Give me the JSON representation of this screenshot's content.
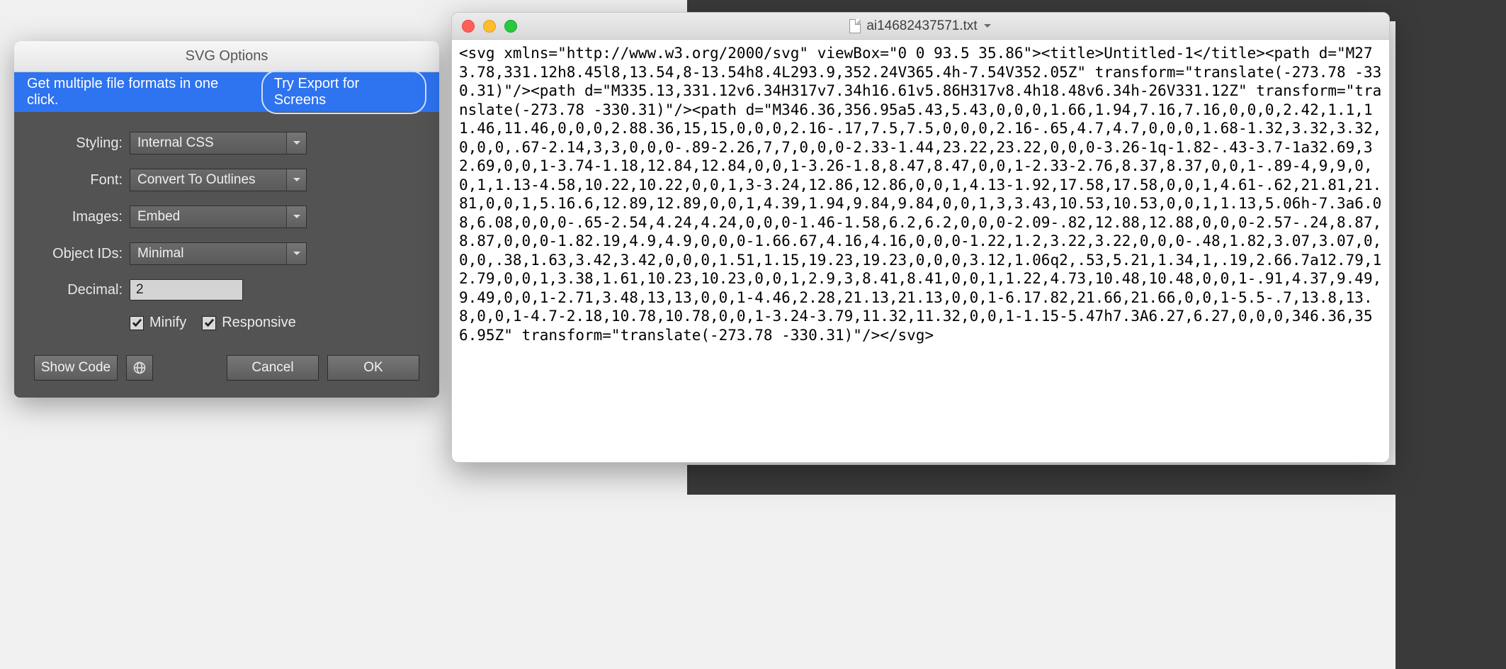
{
  "background": {
    "dark_right_visible": true
  },
  "dialog": {
    "title": "SVG Options",
    "banner_text": "Get multiple file formats in one click.",
    "banner_button": "Try Export for Screens",
    "rows": {
      "styling": {
        "label": "Styling:",
        "value": "Internal CSS"
      },
      "font": {
        "label": "Font:",
        "value": "Convert To Outlines"
      },
      "images": {
        "label": "Images:",
        "value": "Embed"
      },
      "objectids": {
        "label": "Object IDs:",
        "value": "Minimal"
      },
      "decimal": {
        "label": "Decimal:",
        "value": "2"
      }
    },
    "checks": {
      "minify": {
        "label": "Minify",
        "checked": true
      },
      "responsive": {
        "label": "Responsive",
        "checked": true
      }
    },
    "buttons": {
      "showcode": "Show Code",
      "cancel": "Cancel",
      "ok": "OK"
    }
  },
  "txtwindow": {
    "filename": "ai14682437571.txt",
    "content": "<svg xmlns=\"http://www.w3.org/2000/svg\" viewBox=\"0 0 93.5 35.86\"><title>Untitled-1</title><path d=\"M273.78,331.12h8.45l8,13.54,8-13.54h8.4L293.9,352.24V365.4h-7.54V352.05Z\" transform=\"translate(-273.78 -330.31)\"/><path d=\"M335.13,331.12v6.34H317v7.34h16.61v5.86H317v8.4h18.48v6.34h-26V331.12Z\" transform=\"translate(-273.78 -330.31)\"/><path d=\"M346.36,356.95a5.43,5.43,0,0,0,1.66,1.94,7.16,7.16,0,0,0,2.42,1.1,11.46,11.46,0,0,0,2.88.36,15,15,0,0,0,2.16-.17,7.5,7.5,0,0,0,2.16-.65,4.7,4.7,0,0,0,1.68-1.32,3.32,3.32,0,0,0,.67-2.14,3,3,0,0,0-.89-2.26,7,7,0,0,0-2.33-1.44,23.22,23.22,0,0,0-3.26-1q-1.82-.43-3.7-1a32.69,32.69,0,0,1-3.74-1.18,12.84,12.84,0,0,1-3.26-1.8,8.47,8.47,0,0,1-2.33-2.76,8.37,8.37,0,0,1-.89-4,9,9,0,0,1,1.13-4.58,10.22,10.22,0,0,1,3-3.24,12.86,12.86,0,0,1,4.13-1.92,17.58,17.58,0,0,1,4.61-.62,21.81,21.81,0,0,1,5.16.6,12.89,12.89,0,0,1,4.39,1.94,9.84,9.84,0,0,1,3,3.43,10.53,10.53,0,0,1,1.13,5.06h-7.3a6.08,6.08,0,0,0-.65-2.54,4.24,4.24,0,0,0-1.46-1.58,6.2,6.2,0,0,0-2.09-.82,12.88,12.88,0,0,0-2.57-.24,8.87,8.87,0,0,0-1.82.19,4.9,4.9,0,0,0-1.66.67,4.16,4.16,0,0,0-1.22,1.2,3.22,3.22,0,0,0-.48,1.82,3.07,3.07,0,0,0,.38,1.63,3.42,3.42,0,0,0,1.51,1.15,19.23,19.23,0,0,0,3.12,1.06q2,.53,5.21,1.34,1,.19,2.66.7a12.79,12.79,0,0,1,3.38,1.61,10.23,10.23,0,0,1,2.9,3,8.41,8.41,0,0,1,1.22,4.73,10.48,10.48,0,0,1-.91,4.37,9.49,9.49,0,0,1-2.71,3.48,13,13,0,0,1-4.46,2.28,21.13,21.13,0,0,1-6.17.82,21.66,21.66,0,0,1-5.5-.7,13.8,13.8,0,0,1-4.7-2.18,10.78,10.78,0,0,1-3.24-3.79,11.32,11.32,0,0,1-1.15-5.47h7.3A6.27,6.27,0,0,0,346.36,356.95Z\" transform=\"translate(-273.78 -330.31)\"/></svg>"
  }
}
